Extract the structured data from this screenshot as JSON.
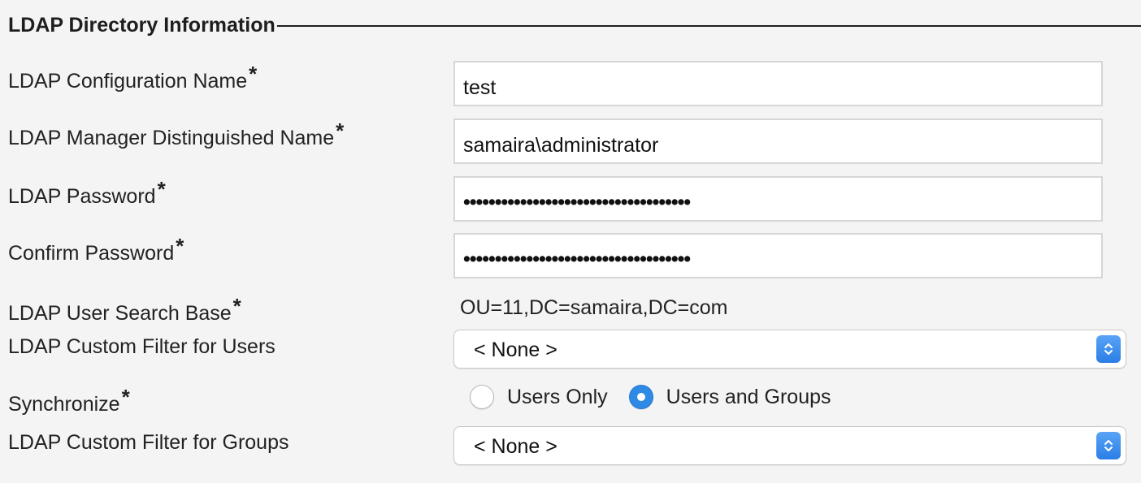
{
  "section": {
    "title": "LDAP Directory Information"
  },
  "required_marker": "*",
  "fields": {
    "config_name": {
      "label": "LDAP Configuration Name",
      "value": "test"
    },
    "manager_dn": {
      "label": "LDAP Manager Distinguished Name",
      "value": "samaira\\administrator"
    },
    "password": {
      "label": "LDAP Password",
      "value": "••••••••••••••••••••••••••••••••••••"
    },
    "confirm_password": {
      "label": "Confirm Password",
      "value": "••••••••••••••••••••••••••••••••••••"
    },
    "search_base": {
      "label": "LDAP User Search Base",
      "value": "OU=11,DC=samaira,DC=com"
    },
    "custom_filter_users": {
      "label": "LDAP Custom Filter for Users",
      "selected": "< None >"
    },
    "synchronize": {
      "label": "Synchronize",
      "options": [
        {
          "label": "Users Only",
          "checked": false
        },
        {
          "label": "Users and Groups",
          "checked": true
        }
      ]
    },
    "custom_filter_groups": {
      "label": "LDAP Custom Filter for Groups",
      "selected": "< None >"
    }
  },
  "icons": {
    "select_arrow": "chevron-up-down-icon"
  },
  "colors": {
    "accent": "#2f8ae6",
    "background": "#f4f4f4"
  }
}
